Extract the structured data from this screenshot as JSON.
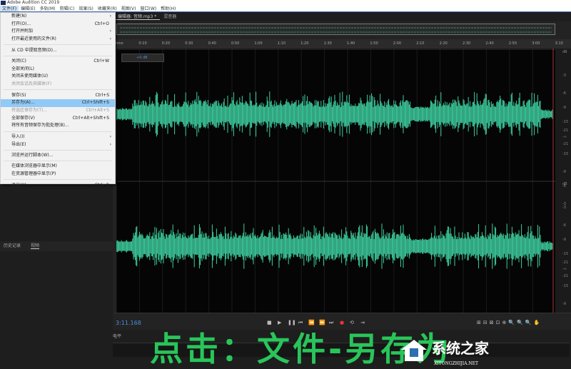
{
  "window": {
    "title": "Adobe Audition CC 2019"
  },
  "menubar": [
    "文件(F)",
    "编辑(E)",
    "多轨(M)",
    "剪辑(C)",
    "效果(S)",
    "收藏夹(R)",
    "视图(V)",
    "窗口(W)",
    "帮助(H)"
  ],
  "file_menu": [
    {
      "label": "新建(N)",
      "submenu": true
    },
    {
      "label": "打开(O)...",
      "shortcut": "Ctrl+O"
    },
    {
      "label": "打开并附加",
      "submenu": true
    },
    {
      "label": "打开最近使用的文件(R)",
      "submenu": true
    },
    {
      "sep": true
    },
    {
      "label": "从 CD 中提取音频(D)..."
    },
    {
      "sep": true
    },
    {
      "label": "关闭(C)",
      "shortcut": "Ctrl+W"
    },
    {
      "label": "全部关闭(L)"
    },
    {
      "label": "关闭未使用媒体(U)"
    },
    {
      "label": "关闭会话及其媒体(F)",
      "disabled": true
    },
    {
      "sep": true
    },
    {
      "label": "保存(S)",
      "shortcut": "Ctrl+S"
    },
    {
      "label": "另存为(A)...",
      "shortcut": "Ctrl+Shift+S",
      "highlighted": true
    },
    {
      "label": "将选区保存为(T)...",
      "shortcut": "Ctrl+Alt+S",
      "disabled": true
    },
    {
      "label": "全部保存(V)",
      "shortcut": "Ctrl+Alt+Shift+S"
    },
    {
      "label": "将所有音频保存为批处理(B)..."
    },
    {
      "sep": true
    },
    {
      "label": "导入(I)",
      "submenu": true
    },
    {
      "label": "导出(E)",
      "submenu": true
    },
    {
      "sep": true
    },
    {
      "label": "浏览并运行脚本(W)..."
    },
    {
      "sep": true
    },
    {
      "label": "在媒体浏览器中显示(M)"
    },
    {
      "label": "在资源管理器中显示(P)"
    },
    {
      "sep": true
    },
    {
      "label": "退出(X)",
      "shortcut": "Ctrl+Q"
    }
  ],
  "editor": {
    "tab_active": "编辑器: 音频.mp3 *",
    "tab_other": "混音器",
    "volume": "+0 dB"
  },
  "ruler": [
    "hms",
    "0:10",
    "0:20",
    "0:30",
    "0:40",
    "0:50",
    "1:00",
    "1:10",
    "1:20",
    "1:30",
    "1:40",
    "1:50",
    "2:00",
    "2:10",
    "2:20",
    "2:30",
    "2:40",
    "2:50",
    "3:00",
    "3:10"
  ],
  "db_scale": [
    "dB",
    "-3",
    "-6",
    "-9",
    "-15",
    "-21",
    "-∞",
    "-21",
    "-15",
    "-9",
    "-6",
    "-3"
  ],
  "left_panel": {
    "tabs": [
      "历史记录",
      "视频"
    ]
  },
  "transport": {
    "time": "3:11.168"
  },
  "levels": {
    "title": "电平"
  },
  "caption": "点击：文件-另存为",
  "watermark": {
    "name": "系统之家",
    "url": "XITONGZHIJIA.NET"
  },
  "colors": {
    "waveform": "#3ecf9f",
    "accent": "#4a90e2",
    "caption": "#29c55a"
  }
}
